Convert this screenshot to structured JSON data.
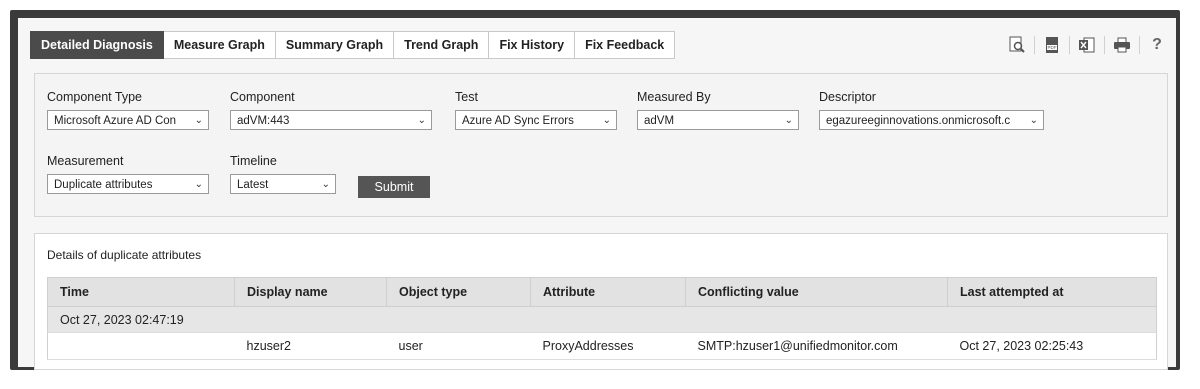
{
  "tabs": [
    {
      "label": "Detailed Diagnosis",
      "active": true
    },
    {
      "label": "Measure Graph"
    },
    {
      "label": "Summary Graph"
    },
    {
      "label": "Trend Graph"
    },
    {
      "label": "Fix History"
    },
    {
      "label": "Fix Feedback"
    }
  ],
  "toolbar": {
    "icons": [
      "search-report-icon",
      "pdf-icon",
      "excel-icon",
      "print-icon",
      "help-icon"
    ],
    "help_label": "?"
  },
  "filters": {
    "component_type": {
      "label": "Component Type",
      "value": "Microsoft Azure AD Con"
    },
    "component": {
      "label": "Component",
      "value": "adVM:443"
    },
    "test": {
      "label": "Test",
      "value": "Azure AD Sync Errors"
    },
    "measured_by": {
      "label": "Measured By",
      "value": "adVM"
    },
    "descriptor": {
      "label": "Descriptor",
      "value": "egazureeginnovations.onmicrosoft.c"
    },
    "measurement": {
      "label": "Measurement",
      "value": "Duplicate attributes"
    },
    "timeline": {
      "label": "Timeline",
      "value": "Latest"
    },
    "submit_label": "Submit"
  },
  "results": {
    "caption": "Details of duplicate attributes",
    "columns": [
      "Time",
      "Display name",
      "Object type",
      "Attribute",
      "Conflicting value",
      "Last attempted at"
    ],
    "group_time": "Oct 27, 2023 02:47:19",
    "rows": [
      [
        "",
        "hzuser2",
        "user",
        "ProxyAddresses",
        "SMTP:hzuser1@unifiedmonitor.com",
        "Oct 27, 2023 02:25:43"
      ]
    ]
  }
}
